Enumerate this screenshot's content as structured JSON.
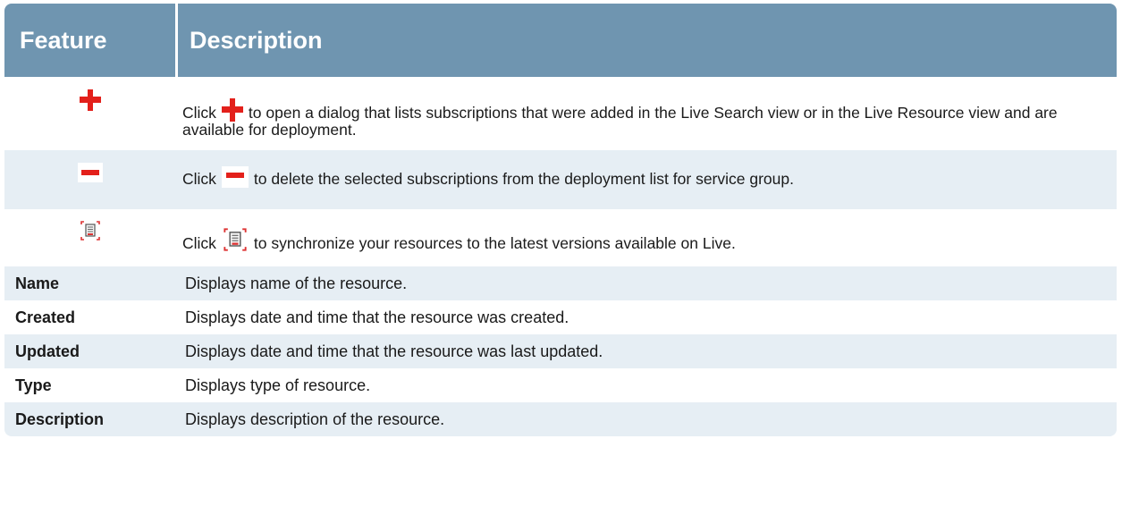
{
  "table": {
    "headers": {
      "feature": "Feature",
      "description": "Description"
    },
    "icon_rows": [
      {
        "icon": "add-plus-icon",
        "text_before": "Click",
        "text_after": "to open a dialog that lists subscriptions that were added in the Live Search view or in the Live Resource view and are available for deployment."
      },
      {
        "icon": "remove-minus-icon",
        "text_before": "Click",
        "text_after": "to delete the selected subscriptions from the deployment list for service group."
      },
      {
        "icon": "sync-resources-icon",
        "text_before": "Click",
        "text_after": "to synchronize your resources to the latest versions available on Live."
      }
    ],
    "rows": [
      {
        "feature": "Name",
        "description": "Displays name of the resource."
      },
      {
        "feature": "Created",
        "description": "Displays date and time that the resource was created."
      },
      {
        "feature": "Updated",
        "description": "Displays date and time that the resource was last updated."
      },
      {
        "feature": "Type",
        "description": "Displays type of resource."
      },
      {
        "feature": "Description",
        "description": "Displays description of the resource."
      }
    ]
  },
  "colors": {
    "header_bg": "#6f95b0",
    "alt_row_bg": "#e6eef4",
    "icon_red": "#e3201b"
  }
}
